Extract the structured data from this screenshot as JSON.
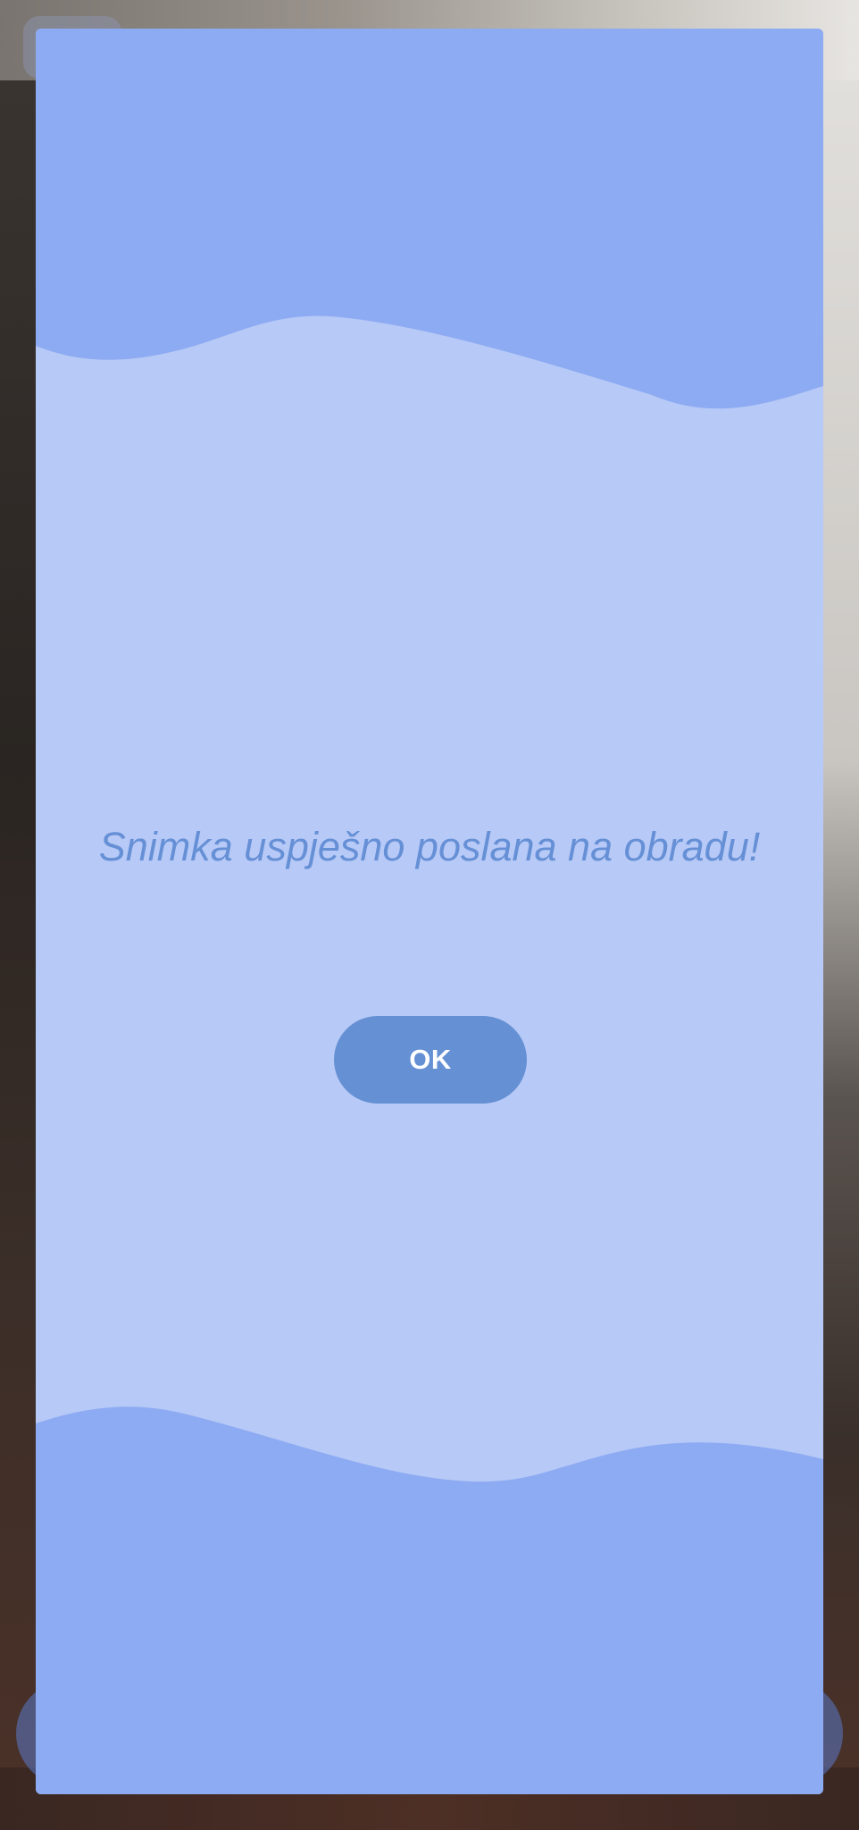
{
  "dialog": {
    "message": "Snimka uspješno poslana na obradu!",
    "ok_label": "OK"
  },
  "colors": {
    "dialog_background": "#b7c9f6",
    "wave": "#8dabf3",
    "message_text": "#6690d6",
    "button_background": "#6590d4",
    "button_text": "#ffffff"
  }
}
